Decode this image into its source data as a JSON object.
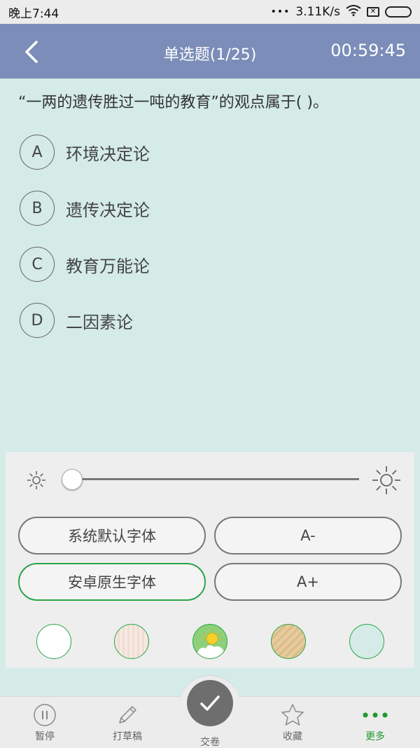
{
  "status_bar": {
    "time": "晚上7:44",
    "network_speed": "3.11K/s",
    "more_indicator": "•••"
  },
  "header": {
    "title": "单选题(1/25)",
    "timer": "00:59:45",
    "back_icon": "chevron-left-icon"
  },
  "question": {
    "text": "“一两的遗传胜过一吨的教育”的观点属于(  )。",
    "options": [
      {
        "letter": "A",
        "text": "环境决定论"
      },
      {
        "letter": "B",
        "text": "遗传决定论"
      },
      {
        "letter": "C",
        "text": "教育万能论"
      },
      {
        "letter": "D",
        "text": "二因素论"
      }
    ]
  },
  "settings_panel": {
    "brightness_fraction": 0.0,
    "font_buttons": {
      "system_font": "系统默认字体",
      "decrease": "A-",
      "android_font": "安卓原生字体",
      "increase": "A+"
    },
    "active_font": "android_font",
    "theme_swatches": [
      {
        "name": "white",
        "color": "#ffffff"
      },
      {
        "name": "pink-wood",
        "color": "#f3e4dc"
      },
      {
        "name": "sunny",
        "color": "#8ed07a"
      },
      {
        "name": "tan-wood",
        "color": "#e3c699"
      },
      {
        "name": "mint",
        "color": "#d4ebe7"
      }
    ]
  },
  "bottom_nav": {
    "pause": "暂停",
    "draft": "打草稿",
    "submit": "交卷",
    "favorite": "收藏",
    "more": "更多"
  },
  "colors": {
    "header_bg": "#7b8db8",
    "page_bg": "#d4ebe7",
    "accent_green": "#2aa548"
  }
}
